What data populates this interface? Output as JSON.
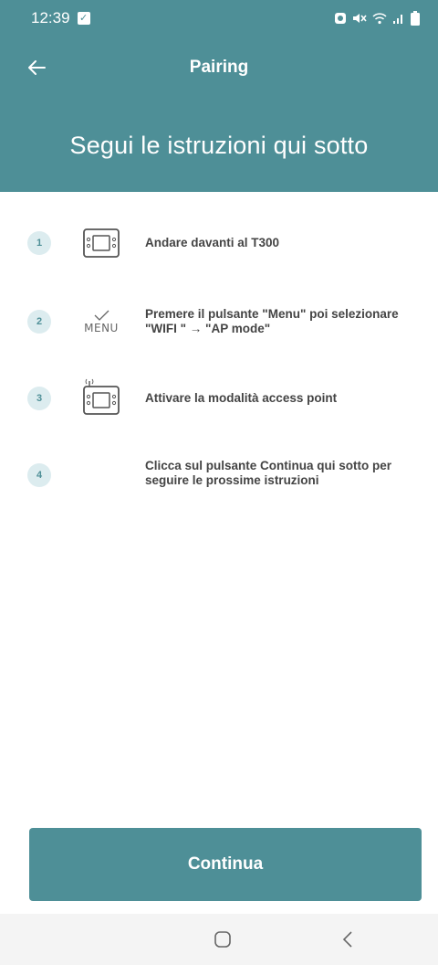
{
  "status_bar": {
    "time": "12:39"
  },
  "app_bar": {
    "title": "Pairing"
  },
  "hero": {
    "title": "Segui le istruzioni qui sotto"
  },
  "steps": [
    {
      "number": "1",
      "icon": "thermostat-icon",
      "text": "Andare davanti al T300"
    },
    {
      "number": "2",
      "icon": "menu-check-icon",
      "icon_label": "MENU",
      "text": "Premere il pulsante \"Menu\" poi selezionare \"WIFI \" → \"AP mode\""
    },
    {
      "number": "3",
      "icon": "thermostat-wifi-icon",
      "text": "Attivare la modalità access point"
    },
    {
      "number": "4",
      "icon": "",
      "text": "Clicca sul pulsante Continua qui sotto per seguire le prossime istruzioni"
    }
  ],
  "actions": {
    "continue_label": "Continua"
  },
  "colors": {
    "primary": "#4e8f97",
    "step_badge_bg": "#dcecef",
    "text": "#444444"
  }
}
